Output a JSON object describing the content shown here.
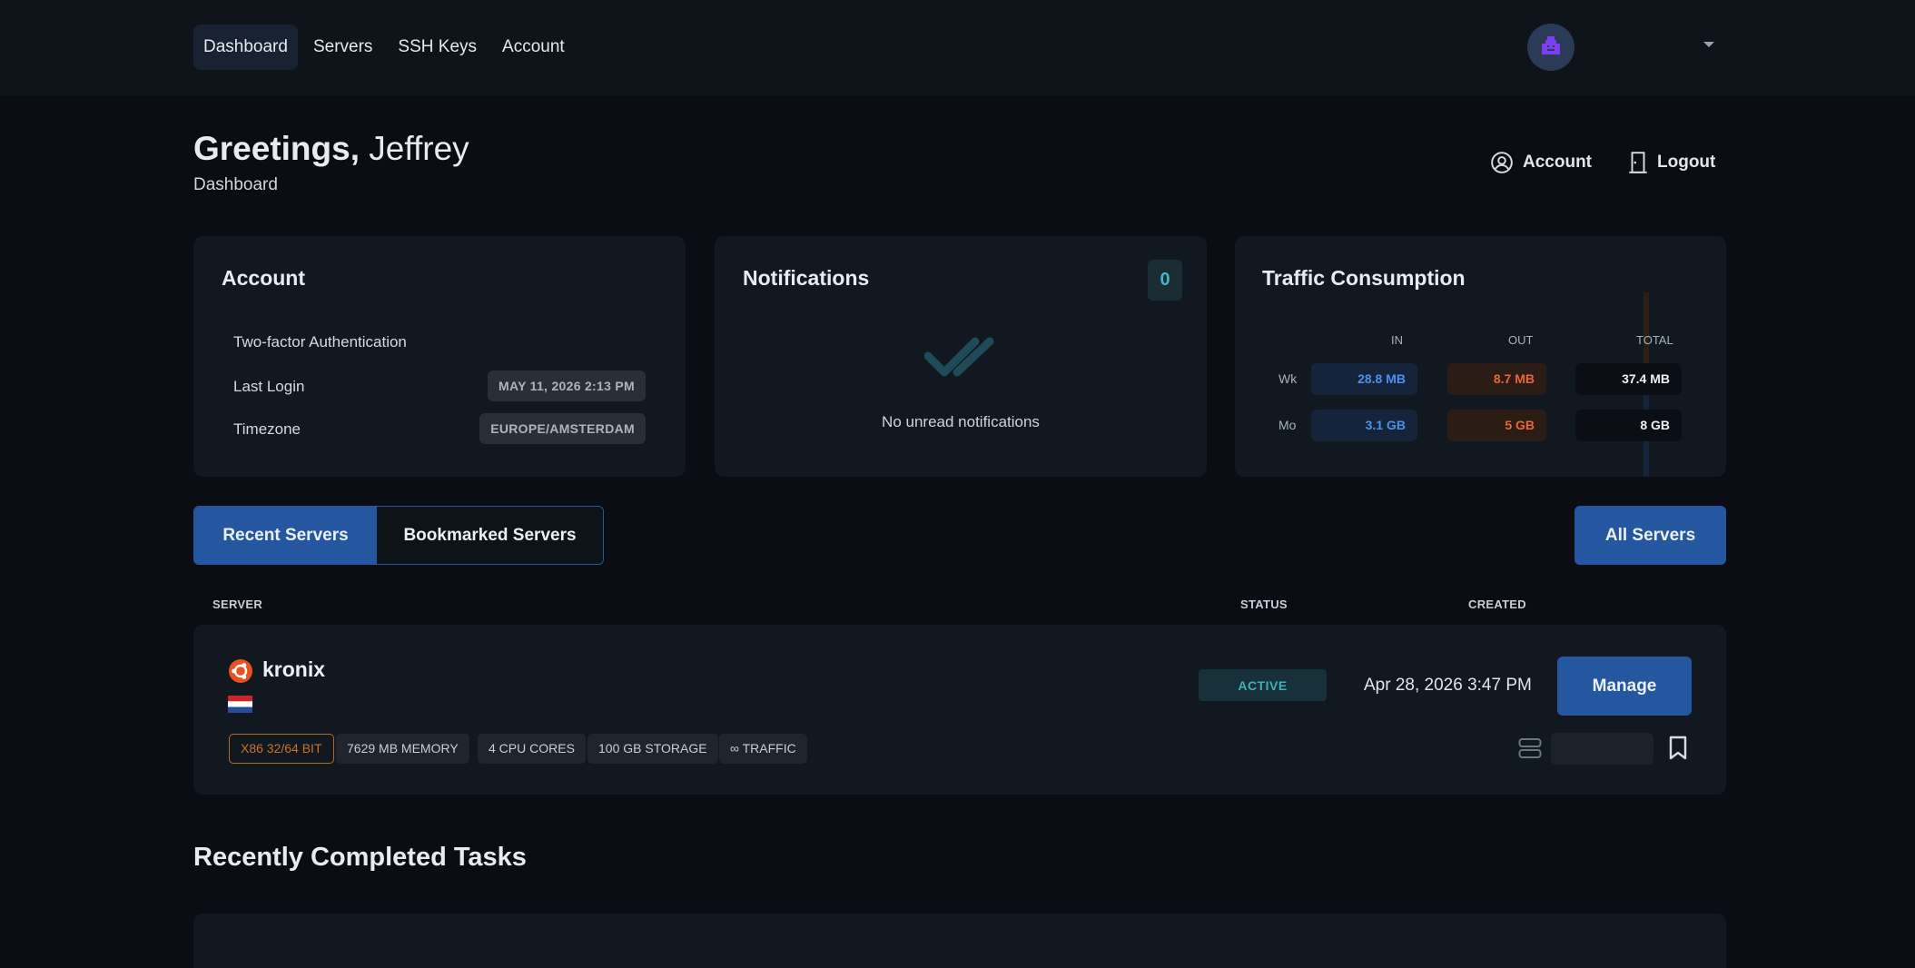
{
  "nav": {
    "items": [
      "Dashboard",
      "Servers",
      "SSH Keys",
      "Account"
    ],
    "active": "Dashboard"
  },
  "header": {
    "greeting": "Greetings,",
    "name": "Jeffrey",
    "subtitle": "Dashboard",
    "account_link": "Account",
    "logout_link": "Logout"
  },
  "account_card": {
    "title": "Account",
    "rows": [
      {
        "label": "Two-factor Authentication",
        "value": ""
      },
      {
        "label": "Last Login",
        "value": "MAY 11, 2026 2:13 PM"
      },
      {
        "label": "Timezone",
        "value": "EUROPE/AMSTERDAM"
      }
    ]
  },
  "notifications_card": {
    "title": "Notifications",
    "count": "0",
    "empty_text": "No unread notifications"
  },
  "traffic_card": {
    "title": "Traffic Consumption",
    "headers": {
      "in": "IN",
      "out": "OUT",
      "total": "TOTAL"
    },
    "rows": [
      {
        "label": "Wk",
        "in": "28.8 MB",
        "out": "8.7 MB",
        "total": "37.4 MB"
      },
      {
        "label": "Mo",
        "in": "3.1 GB",
        "out": "5 GB",
        "total": "8 GB"
      }
    ]
  },
  "tabs": {
    "recent": "Recent Servers",
    "bookmarked": "Bookmarked Servers",
    "all_servers": "All Servers"
  },
  "columns": {
    "server": "SERVER",
    "status": "STATUS",
    "created": "CREATED"
  },
  "server": {
    "name": "kronix",
    "status": "ACTIVE",
    "created": "Apr 28, 2026 3:47 PM",
    "manage_label": "Manage",
    "specs": [
      "X86 32/64 BIT",
      "7629 MB MEMORY",
      "4 CPU CORES",
      "100 GB STORAGE",
      "∞ TRAFFIC"
    ]
  },
  "tasks": {
    "title": "Recently Completed Tasks"
  },
  "colors": {
    "accent": "#2556a0",
    "in": "#4b92ea",
    "out": "#e8673a",
    "status": "#3fb0b8"
  }
}
